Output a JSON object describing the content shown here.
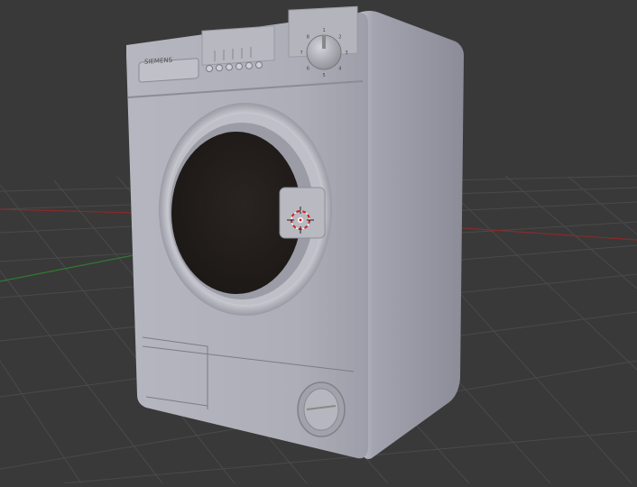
{
  "viewport": {
    "background": "#393939",
    "grid_color": "#4a4a4a",
    "x_axis_color": "#8a2a2a",
    "y_axis_color": "#2f7a2f"
  },
  "washer_model": {
    "body_color": "#a7a7b2",
    "front_color": "#b0b0ba",
    "side_color": "#9c9ca8",
    "glass_color": "#241f1d",
    "brand_text": "SIEMENS",
    "program_dial_labels": [
      "1",
      "2",
      "3",
      "4",
      "5",
      "6",
      "7",
      "8"
    ],
    "button_count": 6
  },
  "cursor_3d": {
    "outer_ring_color": "#d02020",
    "inner_color": "#ffffff"
  }
}
